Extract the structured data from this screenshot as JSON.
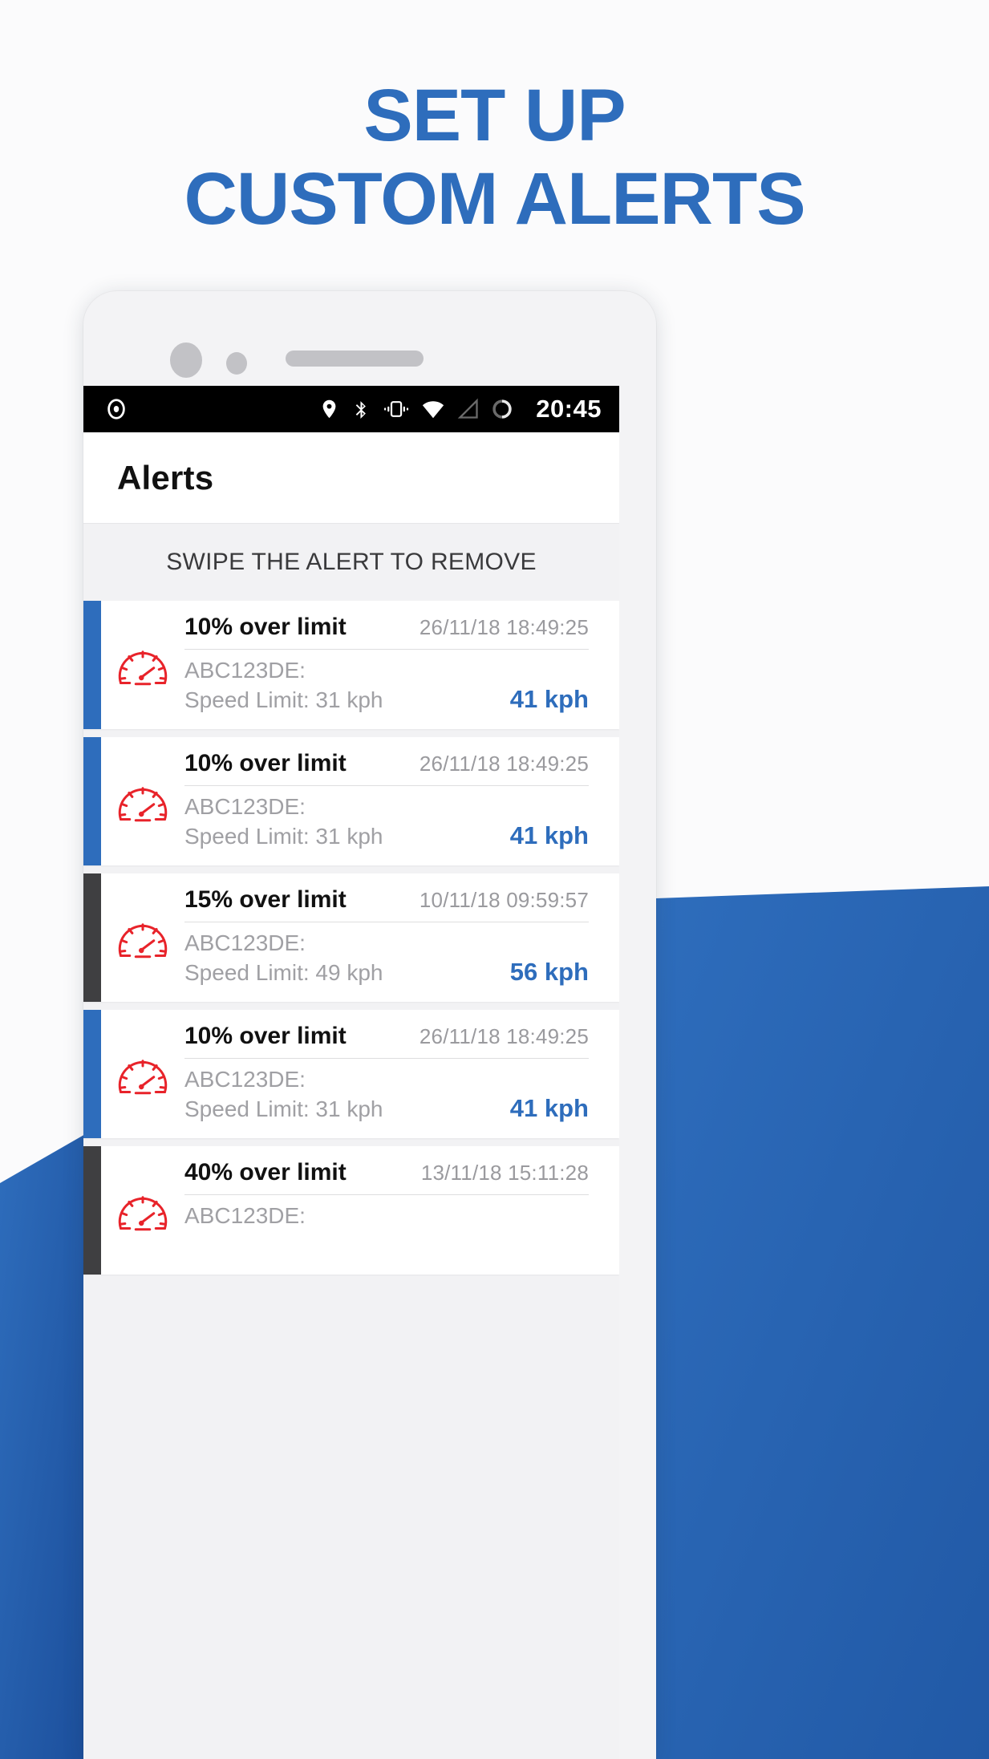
{
  "headline": {
    "line1": "SET UP",
    "line2": "CUSTOM ALERTS",
    "color": "#2e6dbc"
  },
  "phone": {
    "hardware": {
      "camera_large": "front-camera",
      "camera_small": "sensor",
      "speaker": "earpiece-speaker"
    }
  },
  "statusbar": {
    "time": "20:45",
    "left_icons": [
      "record-icon"
    ],
    "right_icons": [
      "location-pin-icon",
      "bluetooth-icon",
      "vibrate-icon",
      "wifi-icon",
      "signal-icon",
      "battery-icon"
    ]
  },
  "appbar": {
    "title": "Alerts"
  },
  "hint": {
    "text": "SWIPE THE ALERT TO REMOVE"
  },
  "colors": {
    "accent_blue": "#2e6dbc",
    "accent_dark": "#3f3f41",
    "gauge_red": "#e8232a",
    "muted_text": "#a0a0a4",
    "screen_bg": "#f2f2f4"
  },
  "alerts": [
    {
      "accent": "blue",
      "icon": "speedometer-icon",
      "title": "10% over limit",
      "timestamp": "26/11/18 18:49:25",
      "plate": "ABC123DE:",
      "limit": "Speed Limit: 31 kph",
      "speed": "41 kph"
    },
    {
      "accent": "blue",
      "icon": "speedometer-icon",
      "title": "10% over limit",
      "timestamp": "26/11/18 18:49:25",
      "plate": "ABC123DE:",
      "limit": "Speed Limit: 31 kph",
      "speed": "41 kph"
    },
    {
      "accent": "dark",
      "icon": "speedometer-icon",
      "title": "15% over limit",
      "timestamp": "10/11/18 09:59:57",
      "plate": "ABC123DE:",
      "limit": "Speed Limit: 49 kph",
      "speed": "56 kph"
    },
    {
      "accent": "blue",
      "icon": "speedometer-icon",
      "title": "10% over limit",
      "timestamp": "26/11/18 18:49:25",
      "plate": "ABC123DE:",
      "limit": "Speed Limit: 31 kph",
      "speed": "41 kph"
    },
    {
      "accent": "dark",
      "icon": "speedometer-icon",
      "title": "40% over limit",
      "timestamp": "13/11/18 15:11:28",
      "plate": "ABC123DE:",
      "limit": "",
      "speed": ""
    }
  ]
}
